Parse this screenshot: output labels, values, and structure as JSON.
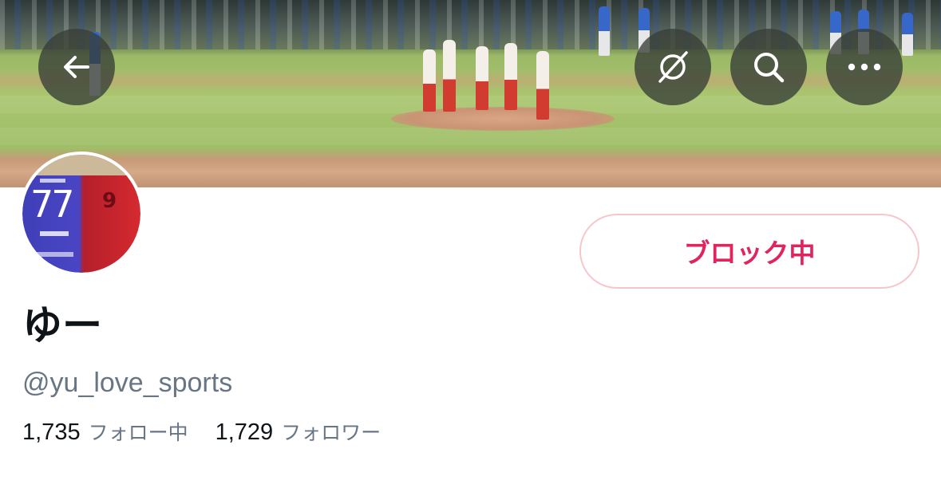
{
  "header": {
    "back_icon": "arrow-left-icon",
    "translate_icon": "globe-slash-icon",
    "search_icon": "search-icon",
    "more_icon": "more-horizontal-icon",
    "banner_image": "baseball-field-banner"
  },
  "profile": {
    "avatar_image": "jersey-avatar",
    "display_name": "ゆー",
    "handle": "@yu_love_sports",
    "block_button_label": "ブロック中",
    "following_count": "1,735",
    "following_label": "フォロー中",
    "followers_count": "1,729",
    "followers_label": "フォロワー"
  },
  "colors": {
    "block_text": "#e0245e",
    "block_border": "#f6c6cd",
    "primary_text": "#0f1419",
    "secondary_text": "#687684"
  }
}
